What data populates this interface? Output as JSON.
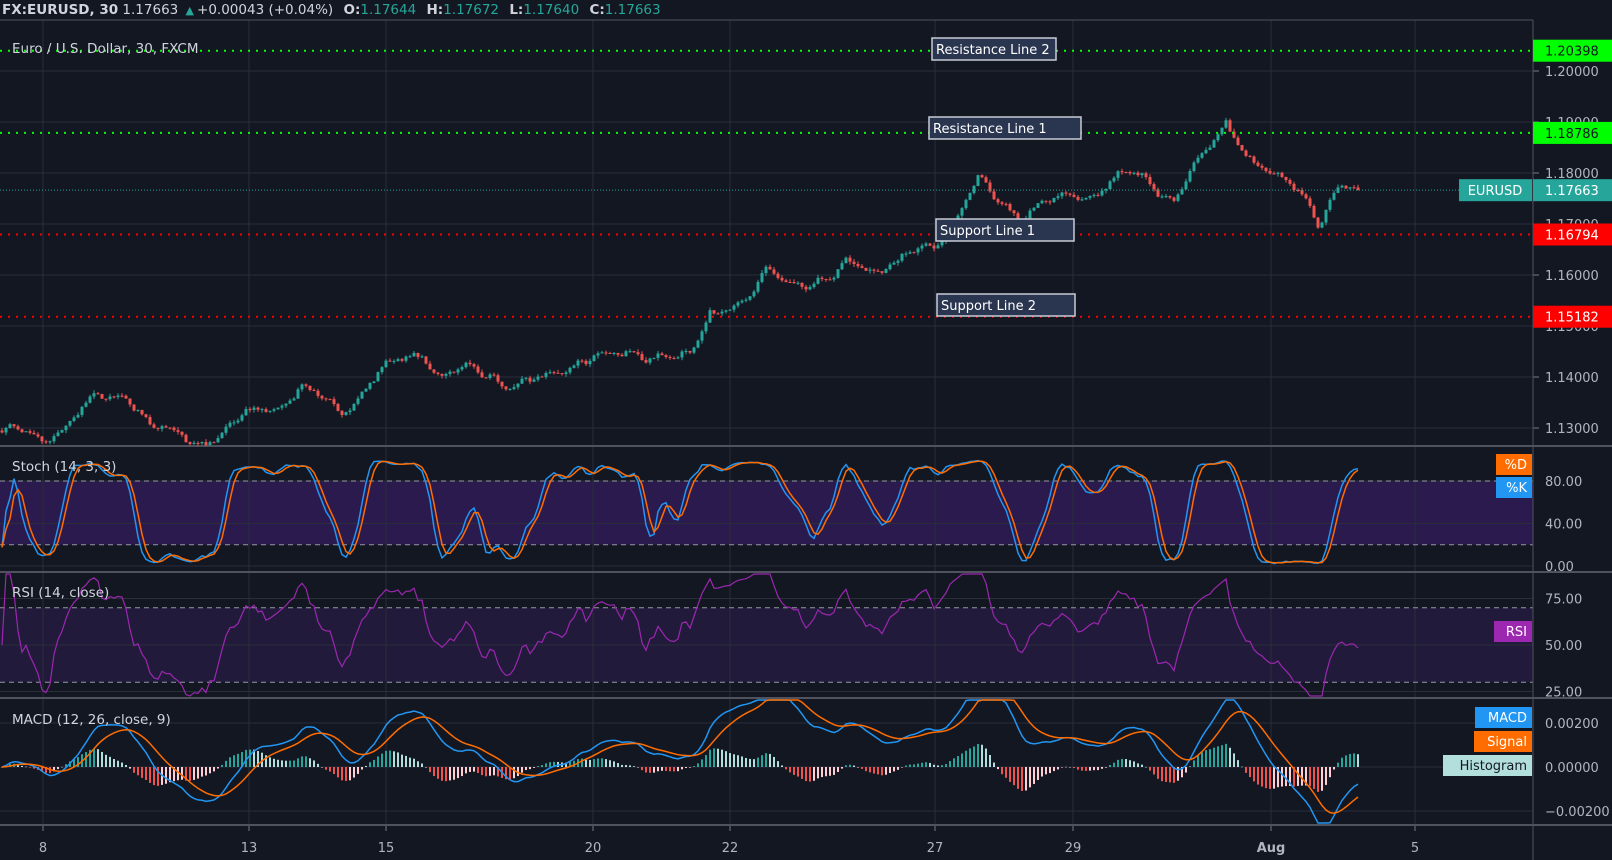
{
  "header": {
    "symbol": "FX:EURUSD, 30",
    "last": "1.17663",
    "change": "+0.00043 (+0.04%)",
    "o_label": "O:",
    "o_value": "1.17644",
    "h_label": "H:",
    "h_value": "1.17672",
    "l_label": "L:",
    "l_value": "1.17640",
    "c_label": "C:",
    "c_value": "1.17663"
  },
  "colors": {
    "background": "#131722",
    "grid": "#2a2e39",
    "up": "#26a69a",
    "down": "#ef5350",
    "resistance": "#00ff00",
    "support": "#ff0000",
    "k": "#2196f3",
    "d": "#ff6d00",
    "rsi": "#9c27b0"
  },
  "chart_data": {
    "type": "candlestick",
    "title": "Euro / U.S. Dollar, 30, FXCM",
    "symbol_tag": "EURUSD",
    "last_price": 1.17663,
    "last_price_label": "1.17663",
    "price_anchors": [
      [
        0,
        1.1295
      ],
      [
        10,
        1.128
      ],
      [
        23,
        1.135
      ],
      [
        31,
        1.137
      ],
      [
        38,
        1.13
      ],
      [
        49,
        1.127
      ],
      [
        59,
        1.131
      ],
      [
        75,
        1.138
      ],
      [
        85,
        1.133
      ],
      [
        95,
        1.141
      ],
      [
        105,
        1.145
      ],
      [
        110,
        1.141
      ],
      [
        123,
        1.141
      ],
      [
        128,
        1.138
      ],
      [
        136,
        1.139
      ],
      [
        144,
        1.144
      ],
      [
        154,
        1.144
      ],
      [
        164,
        1.145
      ],
      [
        172,
        1.143
      ],
      [
        177,
        1.153
      ],
      [
        188,
        1.156
      ],
      [
        191,
        1.16
      ],
      [
        206,
        1.158
      ],
      [
        211,
        1.162
      ],
      [
        224,
        1.162
      ],
      [
        234,
        1.167
      ],
      [
        244,
        1.178
      ],
      [
        254,
        1.172
      ],
      [
        267,
        1.175
      ],
      [
        283,
        1.18
      ],
      [
        293,
        1.175
      ],
      [
        306,
        1.19
      ],
      [
        314,
        1.181
      ],
      [
        326,
        1.176
      ],
      [
        329,
        1.171
      ],
      [
        334,
        1.177
      ],
      [
        339,
        1.17663
      ]
    ],
    "ylim": [
      1.1265,
      1.2075
    ],
    "y_ticks": [
      "1.20000",
      "1.19000",
      "1.18000",
      "1.17000",
      "1.16000",
      "1.15000",
      "1.14000",
      "1.13000"
    ],
    "y_tick_values": [
      1.2,
      1.19,
      1.18,
      1.17,
      1.16,
      1.15,
      1.14,
      1.13
    ],
    "x_ticks": [
      "8",
      "13",
      "15",
      "20",
      "22",
      "27",
      "29",
      "Aug",
      "5"
    ],
    "horizontal_lines": [
      {
        "name": "Resistance Line 2",
        "price": 1.20398,
        "label": "1.20398",
        "kind": "resistance"
      },
      {
        "name": "Resistance Line 1",
        "price": 1.18786,
        "label": "1.18786",
        "kind": "resistance"
      },
      {
        "name": "Support Line 1",
        "price": 1.16794,
        "label": "1.16794",
        "kind": "support"
      },
      {
        "name": "Support Line 2",
        "price": 1.15182,
        "label": "1.15182",
        "kind": "support"
      }
    ],
    "stoch": {
      "title": "Stoch (14, 3, 3)",
      "params": [
        14,
        3,
        3
      ],
      "band": [
        20,
        80
      ],
      "ticks": [
        "80.00",
        "40.00",
        "0.00"
      ],
      "tick_values": [
        80,
        40,
        0
      ],
      "legend": [
        "%D",
        "%K"
      ]
    },
    "rsi": {
      "title": "RSI (14, close)",
      "period": 14,
      "band": [
        30,
        70
      ],
      "ticks": [
        "75.00",
        "50.00",
        "25.00"
      ],
      "tick_values": [
        75,
        50,
        25
      ],
      "legend": "RSI"
    },
    "macd": {
      "title": "MACD (12, 26, close, 9)",
      "params": [
        12,
        26,
        9
      ],
      "ticks": [
        "0.00200",
        "0.00000",
        "−0.00200"
      ],
      "tick_values": [
        0.002,
        0,
        -0.002
      ],
      "legend": [
        "MACD",
        "Signal",
        "Histogram"
      ]
    }
  }
}
